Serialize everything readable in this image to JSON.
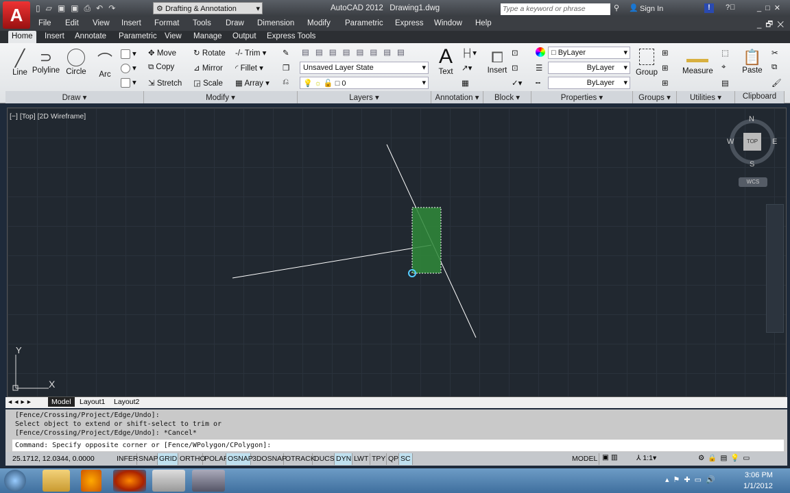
{
  "title_bar": {
    "workspace": "Drafting & Annotation",
    "title": "AutoCAD 2012   Drawing1.dwg",
    "search_placeholder": "Type a keyword or phrase",
    "sign_in": "Sign In"
  },
  "menu": [
    "File",
    "Edit",
    "View",
    "Insert",
    "Format",
    "Tools",
    "Draw",
    "Dimension",
    "Modify",
    "Parametric",
    "Express",
    "Window",
    "Help"
  ],
  "ribbon_tabs": [
    "Home",
    "Insert",
    "Annotate",
    "Parametric",
    "View",
    "Manage",
    "Output",
    "Express Tools"
  ],
  "draw_panel": {
    "label": "Draw",
    "line": "Line",
    "polyline": "Polyline",
    "circle": "Circle",
    "arc": "Arc"
  },
  "modify_panel": {
    "label": "Modify",
    "move": "Move",
    "rotate": "Rotate",
    "trim": "Trim",
    "copy": "Copy",
    "mirror": "Mirror",
    "fillet": "Fillet",
    "stretch": "Stretch",
    "scale": "Scale",
    "array": "Array"
  },
  "layers_panel": {
    "label": "Layers",
    "layer_state": "Unsaved Layer State",
    "current_layer": "0"
  },
  "annotation_panel": {
    "label": "Annotation",
    "text": "Text"
  },
  "block_panel": {
    "label": "Block",
    "insert": "Insert"
  },
  "properties_panel": {
    "label": "Properties",
    "color": "ByLayer",
    "linetype": "ByLayer",
    "lineweight": "ByLayer"
  },
  "groups_panel": {
    "label": "Groups",
    "group": "Group"
  },
  "utilities_panel": {
    "label": "Utilities",
    "measure": "Measure"
  },
  "clipboard_panel": {
    "label": "Clipboard",
    "paste": "Paste"
  },
  "viewport": {
    "label": "[−] [Top] [2D Wireframe]",
    "compass": {
      "n": "N",
      "s": "S",
      "e": "E",
      "w": "W",
      "top": "TOP"
    },
    "wcs": "WCS",
    "ucs_x": "X",
    "ucs_y": "Y"
  },
  "layout_tabs": [
    "Model",
    "Layout1",
    "Layout2"
  ],
  "command_history": [
    "[Fence/Crossing/Project/Edge/Undo]:",
    "Select object to extend or shift-select to trim or",
    "[Fence/Crossing/Project/Edge/Undo]: *Cancel*"
  ],
  "command_line": "Command: Specify opposite corner or [Fence/WPolygon/CPolygon]:",
  "status": {
    "coords": "25.1712, 12.0344, 0.0000",
    "toggles": [
      {
        "label": "INFER",
        "on": false
      },
      {
        "label": "SNAP",
        "on": false
      },
      {
        "label": "GRID",
        "on": true
      },
      {
        "label": "ORTHO",
        "on": false
      },
      {
        "label": "POLAR",
        "on": false
      },
      {
        "label": "OSNAP",
        "on": true
      },
      {
        "label": "3DOSNAP",
        "on": false
      },
      {
        "label": "OTRACK",
        "on": false
      },
      {
        "label": "DUCS",
        "on": false
      },
      {
        "label": "DYN",
        "on": true
      },
      {
        "label": "LWT",
        "on": false
      },
      {
        "label": "TPY",
        "on": false
      },
      {
        "label": "QP",
        "on": false
      },
      {
        "label": "SC",
        "on": true
      }
    ],
    "model": "MODEL",
    "scale": "1:1"
  },
  "taskbar": {
    "time": "3:06 PM",
    "date": "1/1/2012"
  }
}
